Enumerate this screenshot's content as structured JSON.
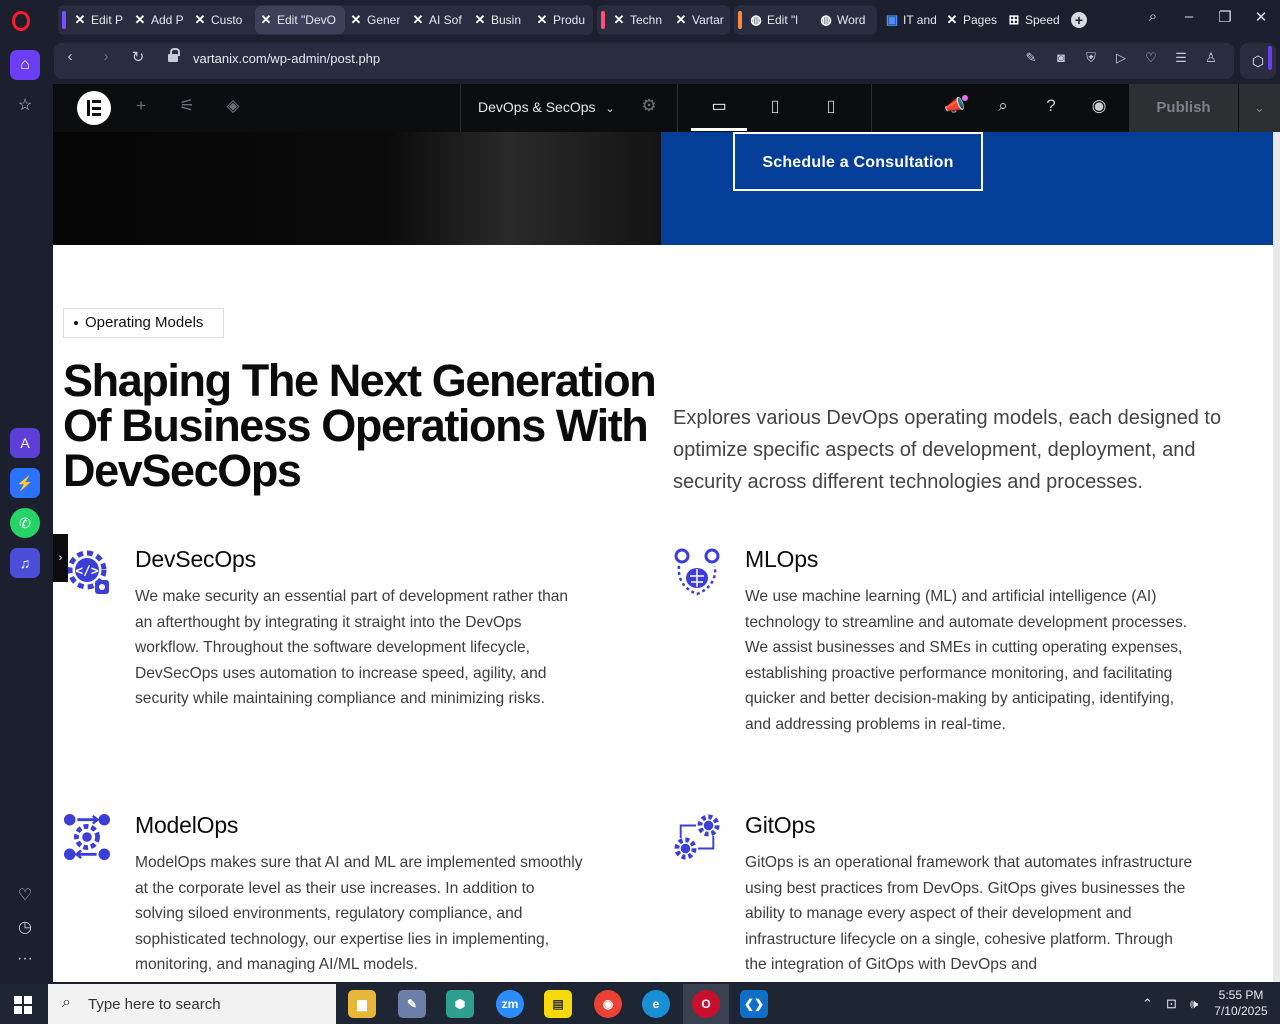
{
  "browser": {
    "tabs": [
      {
        "label": "Edit P",
        "icon": "x-logo-icon"
      },
      {
        "label": "Add P",
        "icon": "x-logo-icon"
      },
      {
        "label": "Custo",
        "icon": "x-logo-icon"
      },
      {
        "label": "Edit \"DevO",
        "icon": "x-logo-icon",
        "active": true
      },
      {
        "label": "Gener",
        "icon": "x-logo-icon"
      },
      {
        "label": "AI Sof",
        "icon": "x-logo-icon"
      },
      {
        "label": "Busin",
        "icon": "x-logo-icon"
      },
      {
        "label": "Produ",
        "icon": "x-logo-icon"
      },
      {
        "label": "Techn",
        "icon": "x-logo-icon"
      },
      {
        "label": "Vartar",
        "icon": "x-logo-icon"
      },
      {
        "label": "Edit \"l",
        "icon": "globe-icon"
      },
      {
        "label": "Word",
        "icon": "globe-icon"
      },
      {
        "label": "IT and",
        "icon": "bookmark-icon"
      },
      {
        "label": "Pages",
        "icon": "x-logo-icon"
      },
      {
        "label": "Speed",
        "icon": "grid-icon"
      }
    ],
    "group_colors": {
      "purple": "#7c4dff",
      "pink": "#ff4d7a",
      "orange": "#ff8a3d"
    },
    "url": "vartanix.com/wp-admin/post.php"
  },
  "elementor": {
    "page_selector": "DevOps & SecOps",
    "publish_label": "Publish"
  },
  "page": {
    "cta_label": "Schedule a Consultation",
    "badge": "Operating Models",
    "headline": "Shaping The Next Generation Of Business Operations With DevSecOps",
    "intro": "Explores various DevOps operating models, each designed to optimize specific aspects of development, deployment, and security across different technologies and processes.",
    "features": [
      {
        "title": "DevSecOps",
        "icon": "code-gear-icon",
        "text": "We make security an essential part of development rather than an afterthought by integrating it straight into the DevOps workflow. Throughout the software development lifecycle, DevSecOps uses automation to increase speed, agility, and security while maintaining compliance and minimizing risks."
      },
      {
        "title": "MLOps",
        "icon": "brain-gears-icon",
        "text": "We use machine learning (ML) and artificial intelligence (AI) technology to streamline and automate development processes. We assist businesses and SMEs in cutting operating expenses, establishing proactive performance monitoring, and facilitating quicker and better decision-making by anticipating, identifying, and addressing problems in real-time."
      },
      {
        "title": "ModelOps",
        "icon": "gear-network-icon",
        "text": "ModelOps makes sure that AI and ML are implemented smoothly at the corporate level as their use increases. In addition to solving siloed environments, regulatory compliance, and sophisticated technology, our expertise lies in implementing, monitoring, and managing AI/ML models."
      },
      {
        "title": "GitOps",
        "icon": "gears-sync-icon",
        "text": "GitOps is an operational framework that automates infrastructure using best practices from DevOps. GitOps gives businesses the ability to manage every aspect of their development and infrastructure lifecycle on a single, cohesive platform. Through the integration of GitOps with DevOps and"
      }
    ],
    "accent_color": "#3b3fd8",
    "hero_blue": "#053e99"
  },
  "taskbar": {
    "search_placeholder": "Type here to search",
    "time": "5:55 PM",
    "date": "7/10/2025"
  }
}
